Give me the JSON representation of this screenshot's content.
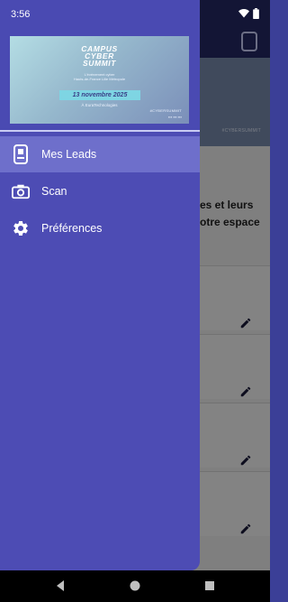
{
  "status_bar": {
    "time": "3:56",
    "icons": [
      "wifi-icon",
      "battery-icon"
    ]
  },
  "drawer": {
    "banner": {
      "title_lines": [
        "CAMPUS",
        "CYBER",
        "SUMMIT"
      ],
      "subtitle_line1": "L'événement cyber",
      "subtitle_line2": "Hauts-de-France Lille Métropole",
      "date": "13 novembre 2025",
      "venue": "À EuraTechnologies",
      "hashtag": "#CYBERSUMMIT"
    },
    "items": [
      {
        "label": "Mes Leads",
        "icon": "leads-icon",
        "active": true
      },
      {
        "label": "Scan",
        "icon": "camera-icon",
        "active": false
      },
      {
        "label": "Préférences",
        "icon": "gear-icon",
        "active": false
      }
    ]
  },
  "background": {
    "hashtag": "#CYBERSUMMIT",
    "text_line1": "es et leurs",
    "text_line2": "otre espace"
  },
  "colors": {
    "drawer": "#4d4cb4",
    "active_item": "#6e6fcb",
    "appbar": "#262a66"
  }
}
